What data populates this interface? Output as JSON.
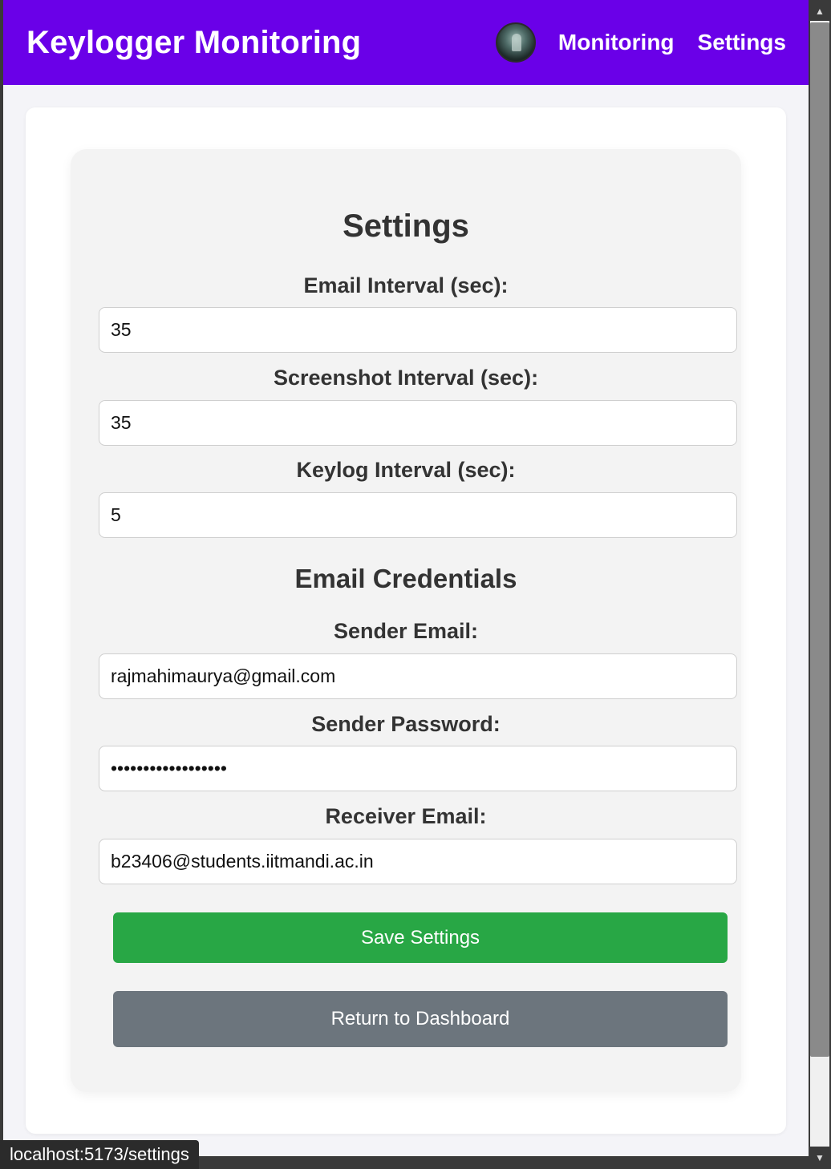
{
  "navbar": {
    "brand": "Keylogger Monitoring",
    "avatar_icon": "profile-avatar",
    "links": [
      "Monitoring",
      "Settings"
    ],
    "color": "#6a00e8"
  },
  "settings": {
    "title": "Settings",
    "email_interval_label": "Email Interval (sec):",
    "email_interval_value": "35",
    "screenshot_interval_label": "Screenshot Interval (sec):",
    "screenshot_interval_value": "35",
    "keylog_interval_label": "Keylog Interval (sec):",
    "keylog_interval_value": "5"
  },
  "credentials": {
    "title": "Email Credentials",
    "sender_email_label": "Sender Email:",
    "sender_email_value": "rajmahimaurya@gmail.com",
    "sender_password_label": "Sender Password:",
    "sender_password_value": "xxxxxxxxxxxxxxxxxx",
    "receiver_email_label": "Receiver Email:",
    "receiver_email_value": "b23406@students.iitmandi.ac.in"
  },
  "buttons": {
    "save": "Save Settings",
    "return": "Return to Dashboard",
    "save_color": "#28a745",
    "return_color": "#6c757d"
  },
  "status_bar": {
    "url": "localhost:5173/settings"
  }
}
